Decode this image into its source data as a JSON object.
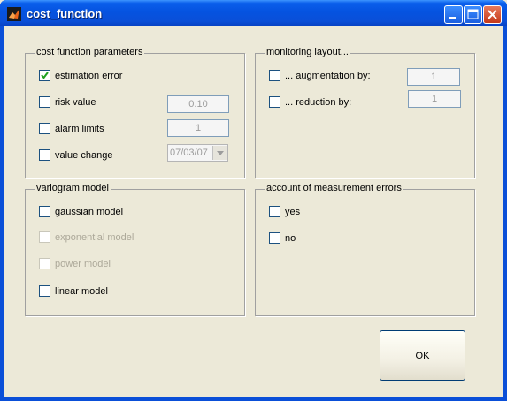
{
  "window": {
    "title": "cost_function"
  },
  "cost_params": {
    "title": "cost function parameters",
    "estimation_error": {
      "label": "estimation error",
      "checked": true
    },
    "risk_value": {
      "label": "risk value",
      "value": "0.10"
    },
    "alarm_limits": {
      "label": "alarm limits",
      "value": "1"
    },
    "value_change": {
      "label": "value change",
      "selected": "07/03/07"
    }
  },
  "monitoring": {
    "title": "monitoring layout...",
    "augmentation": {
      "label": "... augmentation by:",
      "value": "1"
    },
    "reduction": {
      "label": "... reduction by:",
      "value": "1"
    }
  },
  "variogram": {
    "title": "variogram model",
    "gaussian": {
      "label": "gaussian model"
    },
    "exponential": {
      "label": "exponential model"
    },
    "power": {
      "label": "power model"
    },
    "linear": {
      "label": "linear model"
    }
  },
  "measurement": {
    "title": "account of measurement errors",
    "yes": {
      "label": "yes"
    },
    "no": {
      "label": "no"
    }
  },
  "ok_label": "OK"
}
